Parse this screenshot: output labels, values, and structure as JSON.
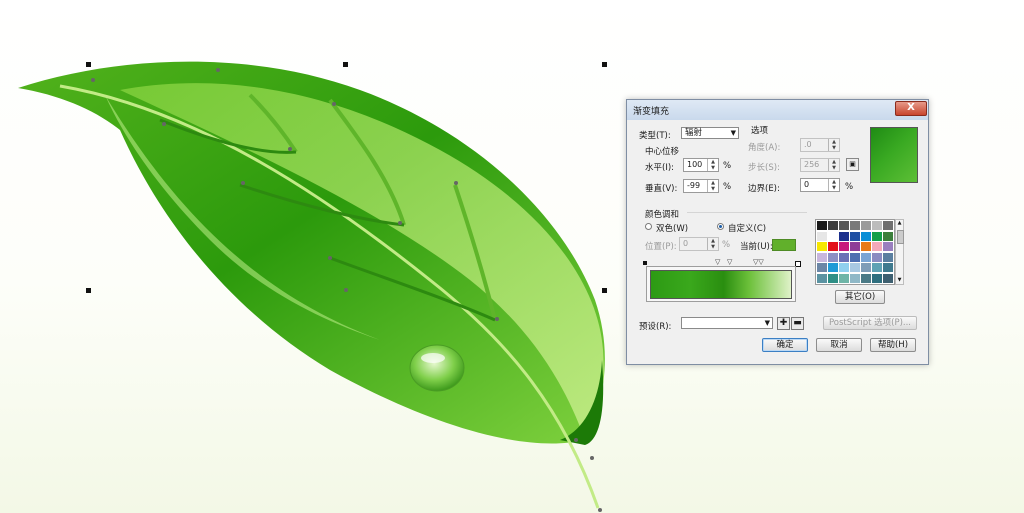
{
  "dialog": {
    "title": "渐变填充",
    "close_label": "X",
    "type": {
      "label": "类型(T):",
      "value": "辐射"
    },
    "center_offset": {
      "heading": "中心位移",
      "horizontal": {
        "label": "水平(I):",
        "value": "100",
        "unit": "%"
      },
      "vertical": {
        "label": "垂直(V):",
        "value": "-99",
        "unit": "%"
      }
    },
    "options": {
      "heading": "选项",
      "angle": {
        "label": "角度(A):",
        "value": ".0"
      },
      "steps": {
        "label": "步长(S):",
        "value": "256"
      },
      "edge_pad": {
        "label": "边界(E):",
        "value": "0",
        "unit": "%"
      }
    },
    "color_blend": {
      "heading": "颜色调和",
      "two_color": "双色(W)",
      "custom": "自定义(C)",
      "selected": "custom",
      "position": {
        "label": "位置(P):",
        "value": "0",
        "unit": "%"
      },
      "current": {
        "label": "当前(U):",
        "color": "#61b02b"
      },
      "other_button": "其它(O)"
    },
    "presets": {
      "label": "预设(R):",
      "value": "",
      "postscript_button": "PostScript 选项(P)..."
    },
    "buttons": {
      "ok": "确定",
      "cancel": "取消",
      "help": "帮助(H)"
    },
    "palette": [
      "#1a1a1a",
      "#3c3c3c",
      "#595959",
      "#7a7a7a",
      "#9b9b9b",
      "#bcbcbc",
      "#6e6e6e",
      "#e6e6e6",
      "#ffffff",
      "#1c2f8c",
      "#1f4fa3",
      "#0a8ed6",
      "#13a04a",
      "#3b7f3b",
      "#f6e600",
      "#e3101b",
      "#c8197c",
      "#8e3c97",
      "#e87a17",
      "#f2a9b9",
      "#9a7fbf",
      "#c8b6dc",
      "#8c8fc4",
      "#6b71b6",
      "#4d6fb1",
      "#7aa5d4",
      "#8a8cc1",
      "#5a7fa0",
      "#6b86a6",
      "#1f9ad6",
      "#8fd0ee",
      "#a8c9e2",
      "#7f9db7",
      "#5fa2b4",
      "#3f7a8e",
      "#5b93a2",
      "#2f8f86",
      "#6fb5a7",
      "#8fb8c7",
      "#4b7a86",
      "#2f6f7f",
      "#3d5f70"
    ]
  }
}
